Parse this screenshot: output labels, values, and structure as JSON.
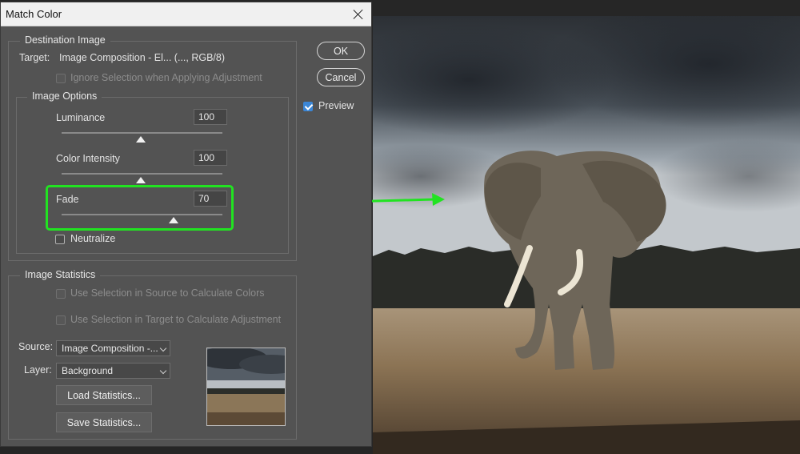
{
  "dialog": {
    "title": "Match Color",
    "ok_label": "OK",
    "cancel_label": "Cancel",
    "preview_label": "Preview",
    "preview_checked": true
  },
  "destination": {
    "group_label": "Destination Image",
    "target_label": "Target:",
    "target_value": "Image Composition - El... (..., RGB/8)",
    "ignore_selection_label": "Ignore Selection when Applying Adjustment"
  },
  "image_options": {
    "group_label": "Image Options",
    "luminance": {
      "label": "Luminance",
      "value": "100",
      "range": [
        1,
        200
      ]
    },
    "color_intensity": {
      "label": "Color Intensity",
      "value": "100",
      "range": [
        1,
        200
      ]
    },
    "fade": {
      "label": "Fade",
      "value": "70",
      "range": [
        0,
        100
      ]
    },
    "neutralize_label": "Neutralize"
  },
  "statistics": {
    "group_label": "Image Statistics",
    "use_selection_source_label": "Use Selection in Source to Calculate Colors",
    "use_selection_target_label": "Use Selection in Target to Calculate Adjustment",
    "source_label": "Source:",
    "source_value": "Image Composition -...",
    "layer_label": "Layer:",
    "layer_value": "Background",
    "load_button": "Load Statistics...",
    "save_button": "Save Statistics..."
  },
  "colors": {
    "highlight": "#21e321",
    "dialog_bg": "#535353",
    "checkbox_accent": "#3b86d6"
  }
}
